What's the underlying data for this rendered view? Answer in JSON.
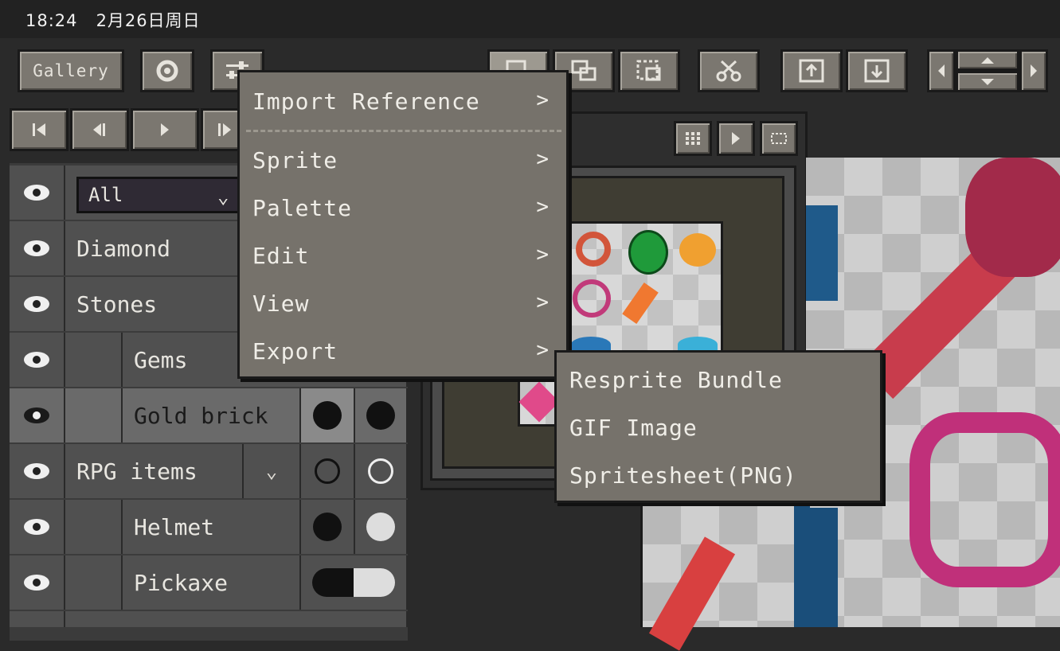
{
  "status": {
    "time": "18:24",
    "date": "2月26日周日"
  },
  "toolbar": {
    "gallery_label": "Gallery"
  },
  "layer_filter": {
    "value": "All"
  },
  "layers": [
    {
      "name": "Diamond",
      "indent": 0
    },
    {
      "name": "Stones",
      "indent": 0
    },
    {
      "name": "Gems",
      "indent": 1
    },
    {
      "name": "Gold brick",
      "indent": 1
    },
    {
      "name": "RPG items",
      "indent": 0
    },
    {
      "name": "Helmet",
      "indent": 1
    },
    {
      "name": "Pickaxe",
      "indent": 1
    }
  ],
  "menu": {
    "items": [
      {
        "label": "Import Reference"
      },
      {
        "label": "Sprite"
      },
      {
        "label": "Palette"
      },
      {
        "label": "Edit"
      },
      {
        "label": "View"
      },
      {
        "label": "Export"
      }
    ],
    "arrow": ">"
  },
  "export_submenu": {
    "items": [
      {
        "label": "Resprite Bundle"
      },
      {
        "label": "GIF Image"
      },
      {
        "label": "Spritesheet(PNG)"
      }
    ]
  },
  "colors": {
    "menu_bg": "#76726b",
    "panel_bg": "#3b3b3b",
    "button_bg": "#7b7770"
  }
}
